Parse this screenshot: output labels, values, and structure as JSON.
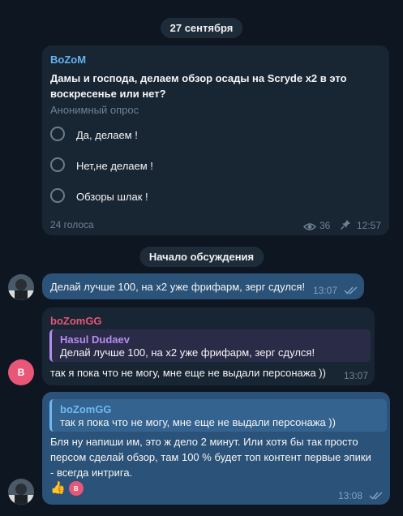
{
  "date_pill": "27 сентября",
  "poll": {
    "sender": "BoZoM",
    "question": "Дамы и господа, делаем обзор осады на Scryde x2 в это воскресенье или нет?",
    "type_label": "Анонимный опрос",
    "options": [
      "Да, делаем !",
      "Нет,не делаем !",
      "Обзоры шлак !"
    ],
    "votes": "24 голоса",
    "views": "36",
    "time": "12:57"
  },
  "discussion_pill": "Начало обсуждения",
  "msg1": {
    "text": "Делай лучше 100, на x2 уже фрифарм, зерг сдулся!",
    "time": "13:07"
  },
  "msg2": {
    "sender": "boZomGG",
    "avatar_letter": "B",
    "quote_author": "Hasul Dudaev",
    "quote_text": "Делай лучше 100, на x2 уже фрифарм, зерг сдулся!",
    "text": "так я пока что не могу, мне еще не выдали персонажа ))",
    "time": "13:07"
  },
  "msg3": {
    "quote_author": "boZomGG",
    "quote_text": "так я пока что не могу, мне еще не выдали персонажа ))",
    "text": "Бля ну напиши им, это ж дело 2 минут.  Или хотя бы так просто персом сделай обзор, там 100 % будет топ контент первые эпики - всегда интрига.",
    "reaction_emoji": "👍",
    "reaction_avatar_letter": "B",
    "time": "13:08"
  },
  "colors": {
    "background": "#0e1621",
    "incoming_bubble": "#182533",
    "outgoing_bubble": "#2b5278",
    "poll_sender": "#64b5ef",
    "pink_sender": "#e85678",
    "purple_sender": "#b48cf2"
  },
  "icons": [
    "eye-icon",
    "pin-icon",
    "double-check-icon",
    "thumbs-up-icon"
  ]
}
